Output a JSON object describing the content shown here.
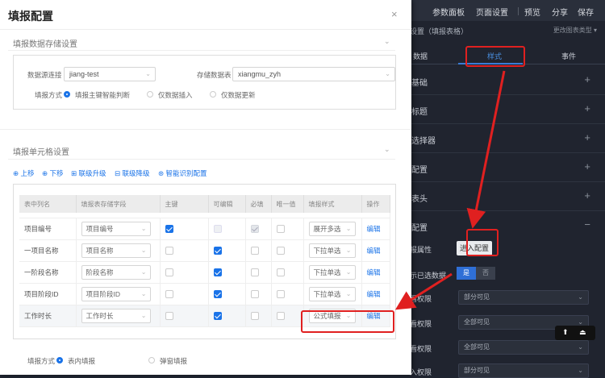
{
  "right_panel": {
    "top_menu": [
      "参数面板",
      "页面设置",
      "预览",
      "分享",
      "保存"
    ],
    "subtitle": "设置（填报表格）",
    "subtitle_right": "更改图表类型",
    "tabs": [
      "数据",
      "样式",
      "事件"
    ],
    "active_tab": "样式",
    "sections": [
      {
        "label": "基础",
        "icon": "+"
      },
      {
        "label": "标题",
        "icon": "+"
      },
      {
        "label": "选择器",
        "icon": "+"
      },
      {
        "label": "配置",
        "icon": "+"
      },
      {
        "label": "表头",
        "icon": "+"
      },
      {
        "label": "配置",
        "icon": "−"
      }
    ],
    "report_attr_label": "报属性",
    "enter_config_button": "进入配置",
    "show_data_label": "示已选数据",
    "toggle_yes": "是",
    "toggle_no": "否",
    "permission_rows": [
      {
        "label": "看权限",
        "value": "部分可见"
      },
      {
        "label": "看权限",
        "value": "全部可见"
      },
      {
        "label": "看权限",
        "value": "全部可见"
      },
      {
        "label": "入权限",
        "value": "部分可见"
      }
    ],
    "float_controls": [
      "⬆",
      "⏏"
    ]
  },
  "modal": {
    "title": "填报配置",
    "close_icon": "×",
    "storage_section": {
      "title": "填报数据存储设置",
      "datasource_label": "数据源连接",
      "datasource_value": "jiang-test",
      "storage_table_label": "存储数据表",
      "storage_table_value": "xiangmu_zyh",
      "fill_mode_label": "填报方式",
      "fill_modes": [
        "填报主键智能判断",
        "仅数据插入",
        "仅数据更新"
      ],
      "fill_mode_selected": 0
    },
    "cell_section": {
      "title": "填报单元格设置",
      "ops": [
        "上移",
        "下移",
        "联级升级",
        "联级降级",
        "智能识别配置"
      ],
      "columns": [
        "表中列名",
        "填报表存储字段",
        "主键",
        "可编辑",
        "必填",
        "唯一值",
        "填报样式",
        "操作"
      ],
      "rows": [
        {
          "name": "项目编号",
          "field": "项目编号",
          "pk": "on",
          "editable": "dis",
          "required": "dison",
          "unique": "off",
          "style": "展开多选",
          "action": "编辑"
        },
        {
          "name": "一项目名称",
          "field": "项目名称",
          "pk": "off",
          "editable": "on",
          "required": "off",
          "unique": "off",
          "style": "下拉单选",
          "action": "编辑"
        },
        {
          "name": "一阶段名称",
          "field": "阶段名称",
          "pk": "off",
          "editable": "on",
          "required": "off",
          "unique": "off",
          "style": "下拉单选",
          "action": "编辑"
        },
        {
          "name": "项目阶段ID",
          "field": "项目阶段ID",
          "pk": "off",
          "editable": "on",
          "required": "off",
          "unique": "off",
          "style": "下拉单选",
          "action": "编辑"
        },
        {
          "name": "工作时长",
          "field": "工作时长",
          "pk": "off",
          "editable": "on",
          "required": "off",
          "unique": "off",
          "style": "公式填报",
          "action": "编辑"
        }
      ],
      "bottom_fill_label": "填报方式",
      "bottom_modes": [
        "表内填报",
        "弹窗填报"
      ],
      "bottom_mode_selected": 0
    }
  },
  "colors": {
    "accent": "#1a73e8",
    "annotation": "#e02020",
    "dark_bg": "#20242f"
  }
}
